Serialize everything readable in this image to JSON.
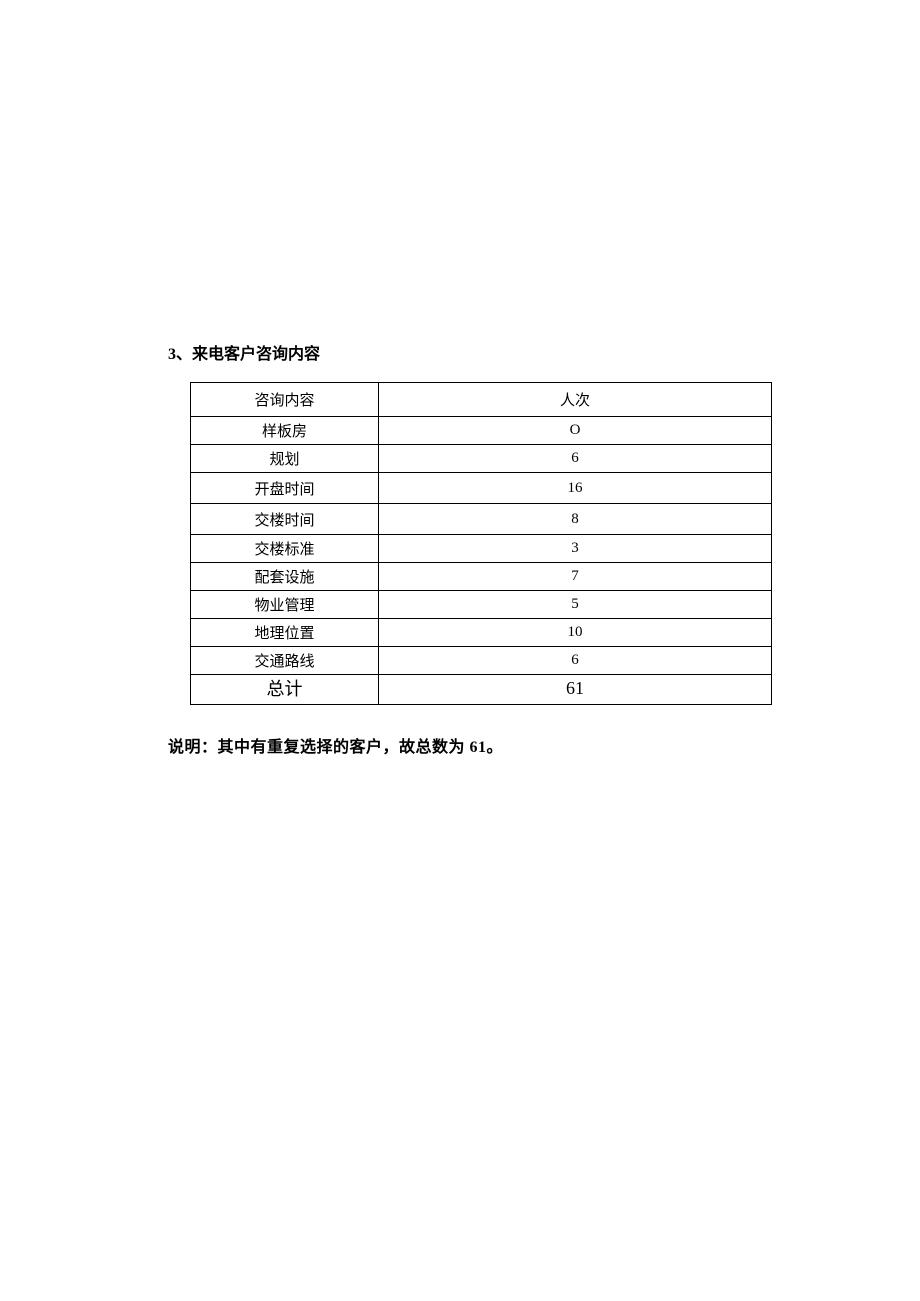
{
  "section_title": "3、来电客户咨询内容",
  "table": {
    "headers": {
      "col1": "咨询内容",
      "col2": "人次"
    },
    "rows": [
      {
        "label": "样板房",
        "value": "O"
      },
      {
        "label": "规划",
        "value": "6"
      },
      {
        "label": "开盘时间",
        "value": "16"
      },
      {
        "label": "交楼时间",
        "value": "8"
      },
      {
        "label": "交楼标准",
        "value": "3"
      },
      {
        "label": "配套设施",
        "value": "7"
      },
      {
        "label": "物业管理",
        "value": "5"
      },
      {
        "label": "地理位置",
        "value": "10"
      },
      {
        "label": "交通路线",
        "value": "6"
      }
    ],
    "total": {
      "label": "总计",
      "value": "61"
    }
  },
  "note": "说明：其中有重复选择的客户，故总数为 61。"
}
